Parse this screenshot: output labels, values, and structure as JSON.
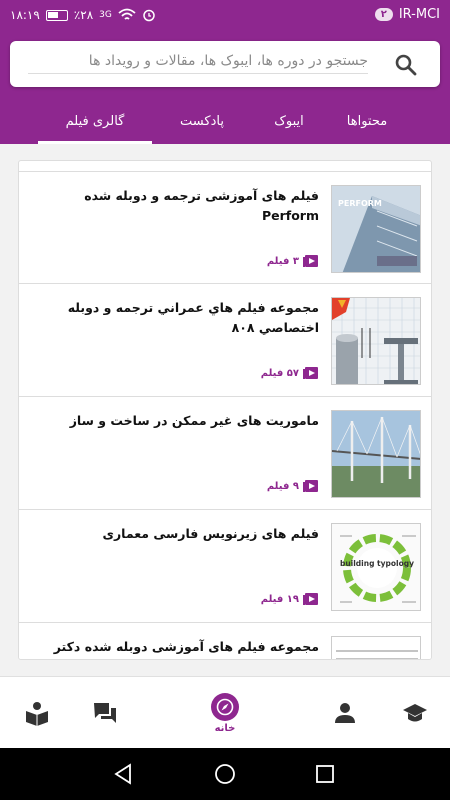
{
  "status": {
    "time": "۱۸:۱۹",
    "battery": "٪۲۸",
    "network": "3G",
    "carrier": "IR-MCI",
    "sim_badge": "۲"
  },
  "search": {
    "placeholder": "جستجو در دوره ها، ایبوک ها، مقالات و رویداد ها"
  },
  "tabs": [
    {
      "label": "محتواها"
    },
    {
      "label": "ایبوک"
    },
    {
      "label": "پادکست"
    },
    {
      "label": "گالری فیلم",
      "active": true
    }
  ],
  "cards": [
    {
      "title": "فیلم های آموزشی ترجمه و دوبله شده Perform",
      "count": "۳ فیلم"
    },
    {
      "title": "مجموعه فیلم هاي عمراني ترجمه و دوبله اختصاصي ۸۰۸",
      "count": "۵۷ فیلم"
    },
    {
      "title": "ماموریت های غیر ممکن در ساخت و ساز",
      "count": "۹ فیلم"
    },
    {
      "title": "فیلم های زیرنویس فارسی معماری",
      "count": "۱۹ فیلم"
    },
    {
      "title": "مجموعه فیلم های آموزشی دوبله شده دکتر سازه",
      "count": ""
    }
  ],
  "thumb_texts": {
    "perform": "PERFORM",
    "typology": "building typology"
  },
  "bottom_nav": {
    "home_label": "خانه"
  },
  "colors": {
    "brand": "#8e278f",
    "icon_gray": "#333333"
  }
}
